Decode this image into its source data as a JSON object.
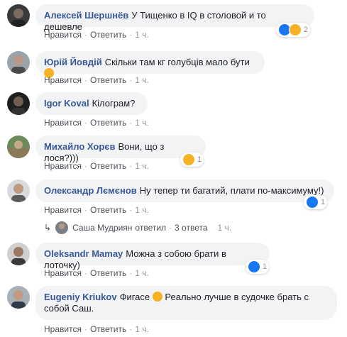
{
  "comments": [
    {
      "author": "Алексей Шершнёв",
      "text": "У Тищенко в IQ в столовой и то дешевле",
      "actions": [
        "Нравится",
        "Ответить",
        "1 ч."
      ],
      "reactions_count": "2"
    },
    {
      "author": "Юрій Йовдій",
      "text": "Скільки там кг голубців мало бути",
      "actions": [
        "Нравится",
        "Ответить",
        "1 ч."
      ]
    },
    {
      "author": "Igor Koval",
      "text": "Кілограм?",
      "actions": [
        "Нравится",
        "Ответить",
        "1 ч."
      ]
    },
    {
      "author": "Михайло Хорєв",
      "text": "Вони, що з лося?)))",
      "actions": [
        "Нравится",
        "Ответить",
        "1 ч."
      ],
      "reactions_count": "1"
    },
    {
      "author": "Олександр Лємєнов",
      "text": "Ну тепер ти багатий, плати по-максимуму!)",
      "actions": [
        "Нравится",
        "Ответить",
        "1 ч."
      ],
      "reactions_count": "1"
    },
    {
      "author": "Oleksandr Mamay",
      "text": "Можна з собою брати в лоточку)",
      "actions": [
        "Нравится",
        "Ответить",
        "1 ч."
      ],
      "reactions_count": "1"
    },
    {
      "author": "Eugeniy Kriukov",
      "text_a": "Фигасе",
      "text_b": "Реально лучше в судочке брать с собой Саш.",
      "actions": [
        "Нравится",
        "Ответить",
        "1 ч."
      ]
    }
  ],
  "reply_summary": {
    "replier": "Саша Мудриян",
    "verb": "ответил",
    "count": "3 ответа",
    "time": "1 ч."
  },
  "colors": {
    "name": "#385898",
    "bubble": "#f2f3f5",
    "meta": "#90949c",
    "like": "#1877f2",
    "haha": "#f7b125"
  },
  "icons": [
    "like-icon",
    "haha-icon",
    "reply-arrow-icon",
    "smile-icon",
    "laugh-icon"
  ]
}
